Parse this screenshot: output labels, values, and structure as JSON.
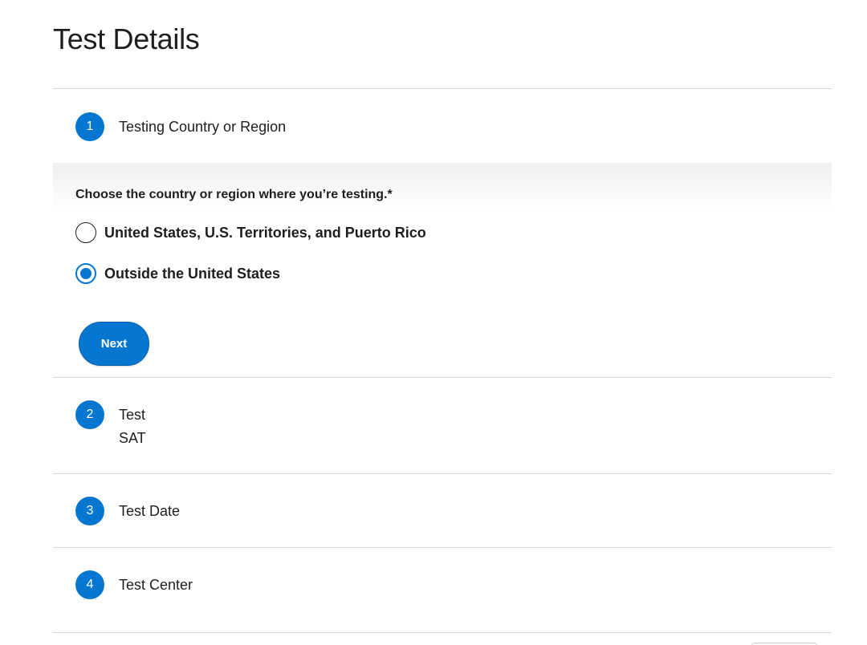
{
  "page": {
    "title": "Test Details"
  },
  "steps": [
    {
      "number": "1",
      "label": "Testing Country or Region"
    },
    {
      "number": "2",
      "label": "Test",
      "value": "SAT"
    },
    {
      "number": "3",
      "label": "Test Date"
    },
    {
      "number": "4",
      "label": "Test Center"
    }
  ],
  "country_question": {
    "prompt": "Choose the country or region where you’re testing.*",
    "options": [
      {
        "label": "United States, U.S. Territories, and Puerto Rico",
        "selected": false
      },
      {
        "label": "Outside the United States",
        "selected": true
      }
    ],
    "next_label": "Next"
  },
  "colors": {
    "accent": "#0677d1",
    "text": "#1e1e1e",
    "divider": "#d9d9d9"
  }
}
